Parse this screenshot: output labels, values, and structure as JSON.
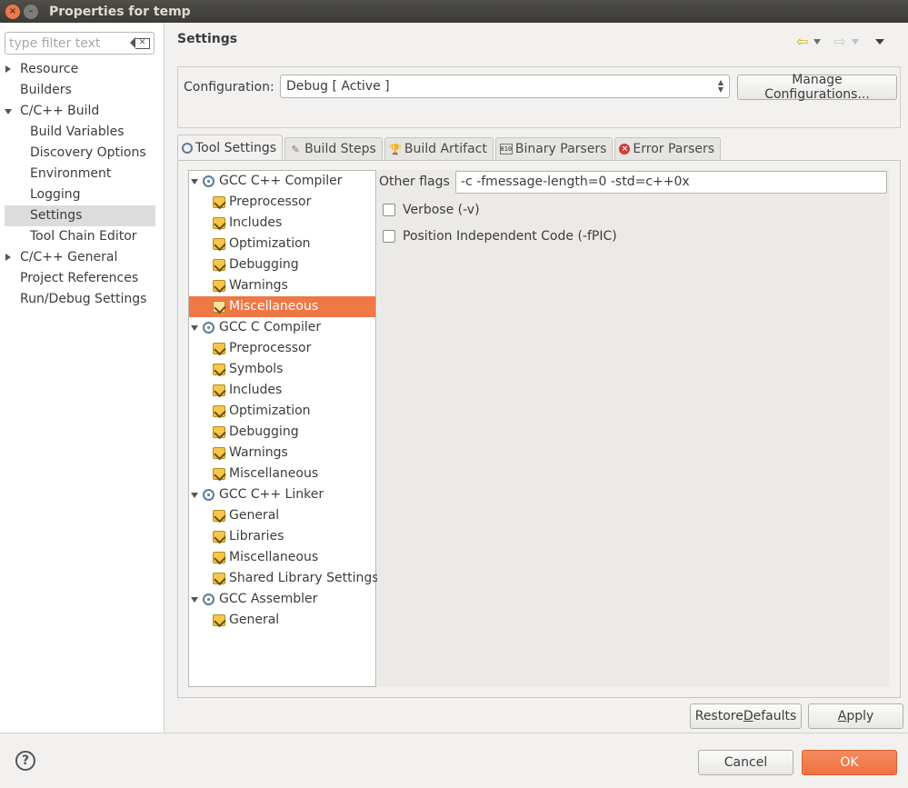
{
  "window": {
    "title": "Properties for temp",
    "close_symbol": "×",
    "minimize_symbol": "–"
  },
  "filter": {
    "placeholder": "type filter text"
  },
  "nav": [
    {
      "label": "Resource",
      "level": 0,
      "expander": "collapsed"
    },
    {
      "label": "Builders",
      "level": 0
    },
    {
      "label": "C/C++ Build",
      "level": 0,
      "expander": "expanded"
    },
    {
      "label": "Build Variables",
      "level": 1
    },
    {
      "label": "Discovery Options",
      "level": 1
    },
    {
      "label": "Environment",
      "level": 1
    },
    {
      "label": "Logging",
      "level": 1
    },
    {
      "label": "Settings",
      "level": 1,
      "selected": true
    },
    {
      "label": "Tool Chain Editor",
      "level": 1
    },
    {
      "label": "C/C++ General",
      "level": 0,
      "expander": "collapsed"
    },
    {
      "label": "Project References",
      "level": 0
    },
    {
      "label": "Run/Debug Settings",
      "level": 0
    }
  ],
  "header": {
    "title": "Settings",
    "back_icon": "arrow-back-icon",
    "forward_icon": "arrow-forward-icon"
  },
  "configuration": {
    "label": "Configuration:",
    "value": "Debug  [ Active ]",
    "manage_button": "Manage Configurations..."
  },
  "tabs": [
    {
      "label": "Tool Settings",
      "icon": "gear-icon",
      "active": true
    },
    {
      "label": "Build Steps",
      "icon": "wand-icon"
    },
    {
      "label": "Build Artifact",
      "icon": "trophy-icon"
    },
    {
      "label": "Binary Parsers",
      "icon": "binary-icon"
    },
    {
      "label": "Error Parsers",
      "icon": "error-icon"
    }
  ],
  "tool_tree": [
    {
      "label": "GCC C++ Compiler",
      "children": [
        {
          "label": "Preprocessor"
        },
        {
          "label": "Includes"
        },
        {
          "label": "Optimization"
        },
        {
          "label": "Debugging"
        },
        {
          "label": "Warnings"
        },
        {
          "label": "Miscellaneous",
          "selected": true
        }
      ]
    },
    {
      "label": "GCC C Compiler",
      "children": [
        {
          "label": "Preprocessor"
        },
        {
          "label": "Symbols"
        },
        {
          "label": "Includes"
        },
        {
          "label": "Optimization"
        },
        {
          "label": "Debugging"
        },
        {
          "label": "Warnings"
        },
        {
          "label": "Miscellaneous"
        }
      ]
    },
    {
      "label": "GCC C++ Linker",
      "children": [
        {
          "label": "General"
        },
        {
          "label": "Libraries"
        },
        {
          "label": "Miscellaneous"
        },
        {
          "label": "Shared Library Settings"
        }
      ]
    },
    {
      "label": "GCC Assembler",
      "children": [
        {
          "label": "General"
        }
      ]
    }
  ],
  "settings": {
    "other_flags_label": "Other flags",
    "other_flags_value": "-c -fmessage-length=0 -std=c++0x",
    "verbose_label": "Verbose (-v)",
    "verbose_checked": false,
    "fpic_label": "Position Independent Code (-fPIC)",
    "fpic_checked": false
  },
  "buttons": {
    "restore_pre": "Restore ",
    "restore_accel": "D",
    "restore_post": "efaults",
    "apply_accel": "A",
    "apply_post": "pply",
    "cancel": "Cancel",
    "ok": "OK",
    "help": "?"
  },
  "colors": {
    "accent": "#f07746",
    "selection_gray": "#dcdcdc",
    "titlebar": "#3c3b37"
  }
}
